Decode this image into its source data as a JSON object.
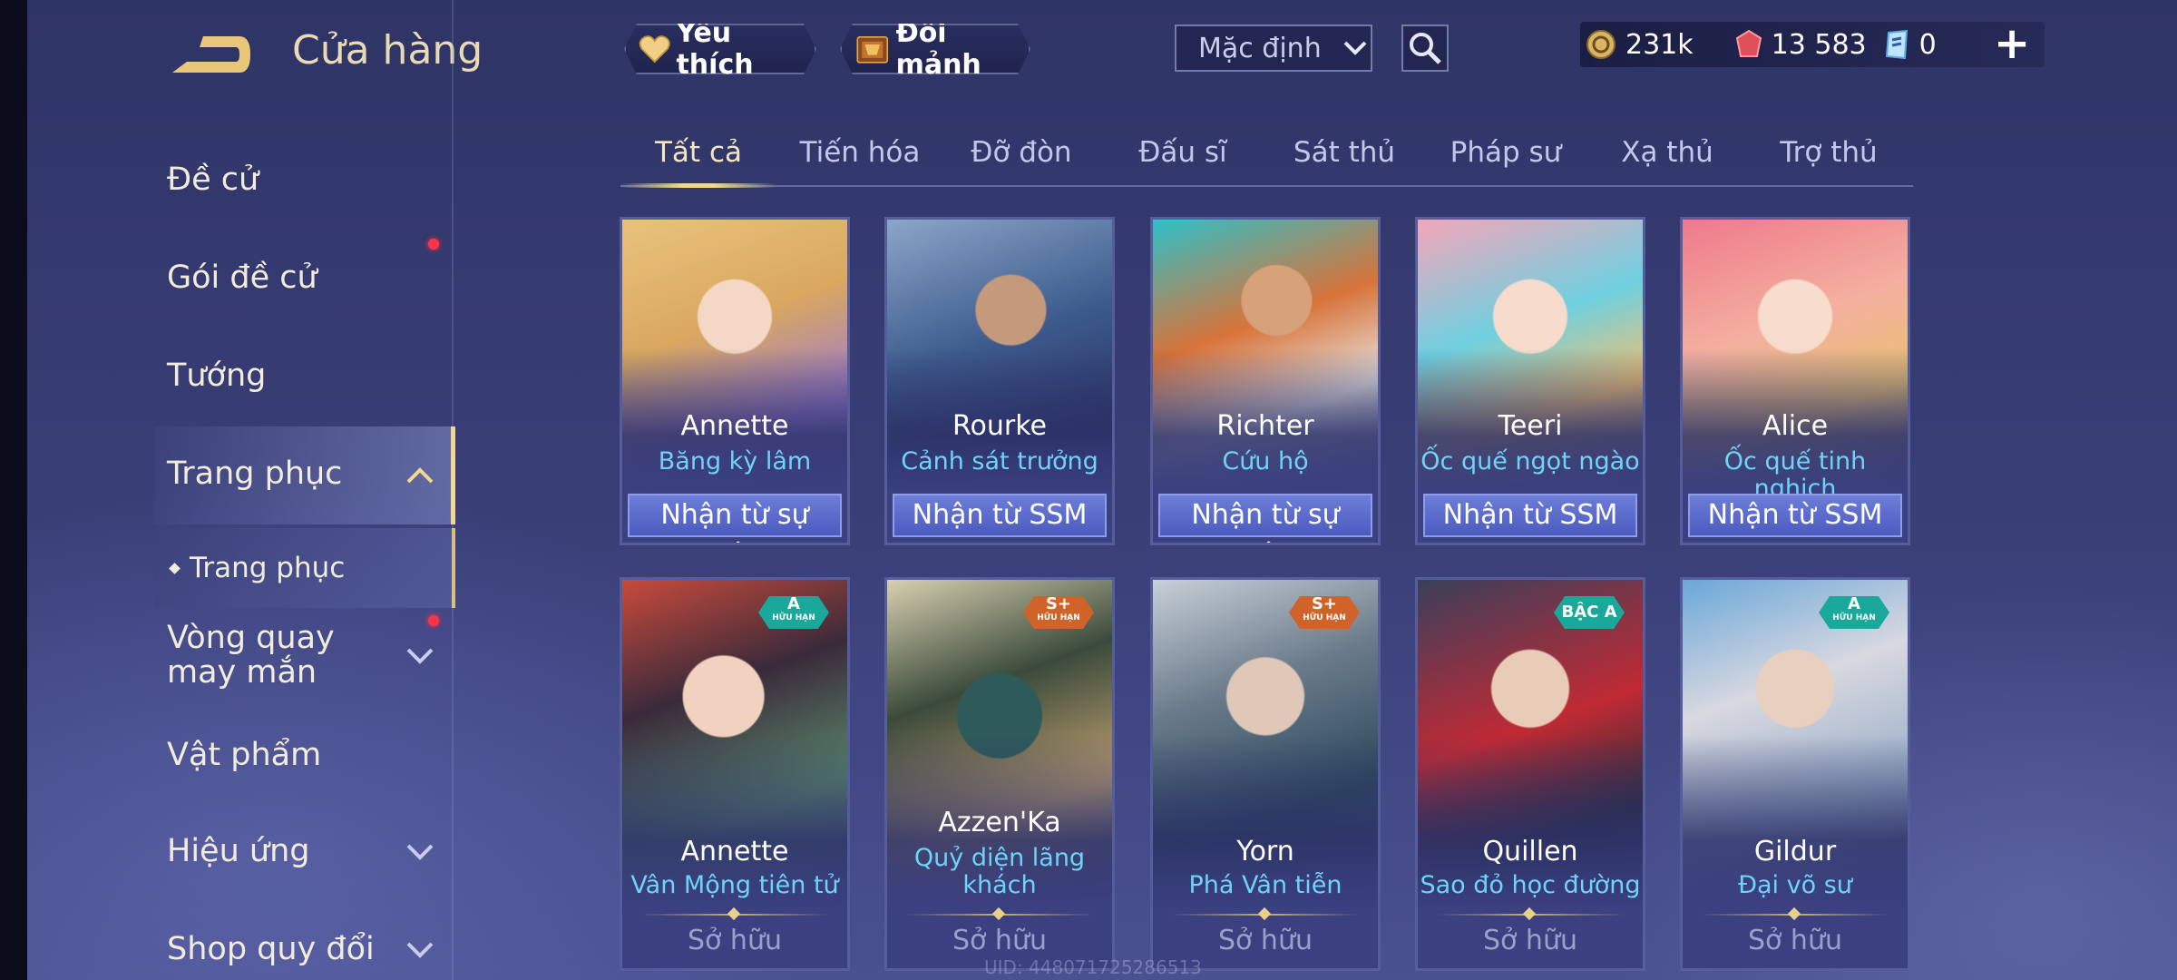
{
  "header": {
    "title": "Cửa hàng",
    "favorite_label": "Yêu thích",
    "exchange_label": "Đổi mảnh",
    "sort_value": "Mặc định",
    "currencies": [
      {
        "icon": "gold-coin-icon",
        "value": "231k"
      },
      {
        "icon": "ruby-gem-icon",
        "value": "13 583"
      },
      {
        "icon": "voucher-icon",
        "value": "0"
      }
    ]
  },
  "sidebar": {
    "items": [
      {
        "label": "Đề cử"
      },
      {
        "label": "Gói đề cử"
      },
      {
        "label": "Tướng"
      },
      {
        "label": "Trang phục"
      },
      {
        "label": "Vòng quay may mắn"
      },
      {
        "label": "Vật phẩm"
      },
      {
        "label": "Hiệu ứng"
      },
      {
        "label": "Shop quy đổi"
      }
    ],
    "sub_item": "Trang phục"
  },
  "tabs": [
    "Tất cả",
    "Tiến hóa",
    "Đỡ đòn",
    "Đấu sĩ",
    "Sát thủ",
    "Pháp sư",
    "Xạ thủ",
    "Trợ thủ"
  ],
  "cards_row1": [
    {
      "hero": "Annette",
      "skin": "Băng kỳ lâm",
      "action": "Nhận từ sự kiện"
    },
    {
      "hero": "Rourke",
      "skin": "Cảnh sát trưởng",
      "action": "Nhận từ SSM"
    },
    {
      "hero": "Richter",
      "skin": "Cứu hộ",
      "action": "Nhận từ sự kiện"
    },
    {
      "hero": "Teeri",
      "skin": "Ốc quế ngọt ngào",
      "action": "Nhận từ SSM"
    },
    {
      "hero": "Alice",
      "skin": "Ốc quế tinh nghịch",
      "action": "Nhận từ SSM"
    }
  ],
  "cards_row2": [
    {
      "hero": "Annette",
      "skin": "Vân Mộng tiên tử",
      "status": "Sở hữu",
      "rank": "A",
      "rank_sub": "HỮU HẠN"
    },
    {
      "hero": "Azzen'Ka",
      "skin": "Quỷ diện lãng khách",
      "status": "Sở hữu",
      "rank": "S+",
      "rank_sub": "HỮU HẠN"
    },
    {
      "hero": "Yorn",
      "skin": "Phá Vân tiễn",
      "status": "Sở hữu",
      "rank": "S+",
      "rank_sub": "HỮU HẠN"
    },
    {
      "hero": "Quillen",
      "skin": "Sao đỏ học đường",
      "status": "Sở hữu",
      "rank": "BẬC A",
      "rank_sub": ""
    },
    {
      "hero": "Gildur",
      "skin": "Đại võ sư",
      "status": "Sở hữu",
      "rank": "A",
      "rank_sub": "HỮU HẠN"
    }
  ],
  "uid_text": "UID: 448071725286513",
  "colors": {
    "accent_gold": "#f0d890",
    "skin_name_cyan": "#6fd3f7",
    "button_blue": "#5a69cc",
    "notification_red": "#ff3448"
  }
}
